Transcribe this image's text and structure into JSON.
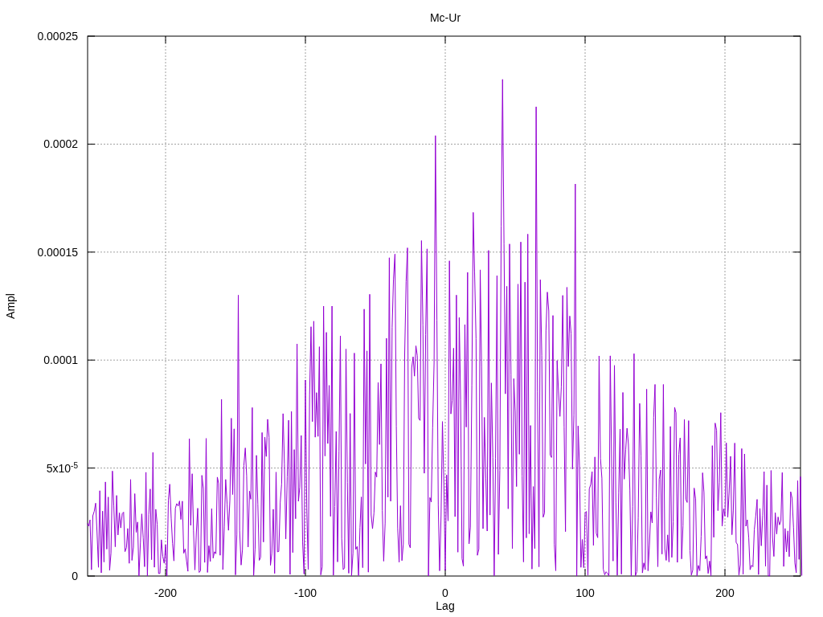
{
  "chart": {
    "title": "Mc-Ur",
    "xlabel": "Lag",
    "ylabel": "Ampl",
    "xticks": [
      "-200",
      "-100",
      "0",
      "100",
      "200"
    ],
    "yticks": [
      "0.00025",
      "0.0002",
      "0.00015",
      "0.0001",
      "5x10$^{-5}$",
      "0"
    ]
  }
}
